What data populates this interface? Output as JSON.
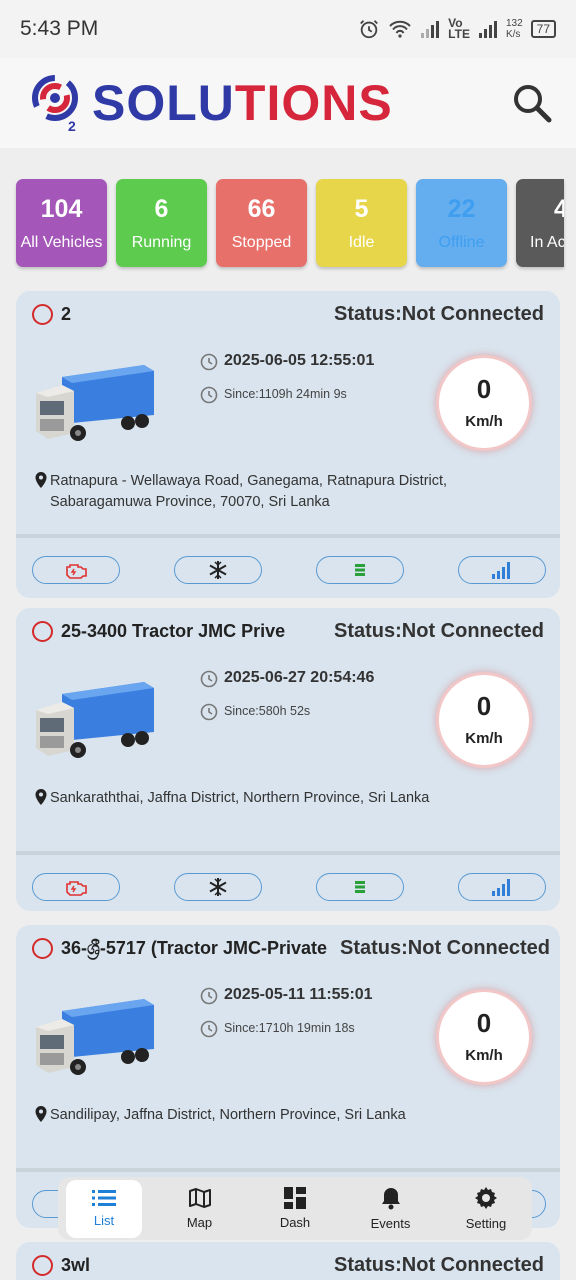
{
  "status_bar": {
    "time": "5:43 PM",
    "net_speed_top": "132",
    "net_speed_bottom": "K/s",
    "battery": "77",
    "volte_top": "Vo",
    "volte_bottom": "LTE"
  },
  "header": {
    "logo_sub": "2",
    "brand_blue_1": "SOLU",
    "brand_red": "TIONS",
    "brand_blue_2": ""
  },
  "summary": [
    {
      "count": "104",
      "label": "All Vehicles",
      "color": "#a457b8"
    },
    {
      "count": "6",
      "label": "Running",
      "color": "#5ccb4e"
    },
    {
      "count": "66",
      "label": "Stopped",
      "color": "#e8706a"
    },
    {
      "count": "5",
      "label": "Idle",
      "color": "#e7d64a"
    },
    {
      "count": "22",
      "label": "Offline",
      "color": "#64aef0"
    },
    {
      "count": "4",
      "label": "In Ac",
      "color": "#5a5a5a"
    }
  ],
  "vehicles": [
    {
      "name": "2",
      "status": "Status:Not Connected",
      "datetime": "2025-06-05 12:55:01",
      "since": "Since:1109h 24min 9s",
      "speed": "0",
      "unit": "Km/h",
      "address": "Ratnapura - Wellawaya Road, Ganegama, Ratnapura District, Sabaragamuwa Province, 70070, Sri Lanka"
    },
    {
      "name": "25-3400  Tractor JMC Prive",
      "status": "Status:Not Connected",
      "datetime": "2025-06-27 20:54:46",
      "since": "Since:580h 52s",
      "speed": "0",
      "unit": "Km/h",
      "address": "Sankaraththai, Jaffna District, Northern Province, Sri Lanka"
    },
    {
      "name": "36-ශ්‍රී-5717 (Tractor JMC-Private",
      "status": "Status:Not Connected",
      "datetime": "2025-05-11 11:55:01",
      "since": "Since:1710h 19min 18s",
      "speed": "0",
      "unit": "Km/h",
      "address": "Sandilipay, Jaffna District, Northern Province, Sri Lanka"
    },
    {
      "name": "3wl",
      "status": "Status:Not Connected"
    }
  ],
  "nav": {
    "list": "List",
    "map": "Map",
    "dash": "Dash",
    "events": "Events",
    "setting": "Setting"
  },
  "colors": {
    "accent": "#1e7fd8",
    "status_ring": "#d42a2a",
    "card_bg": "#d9e4ee"
  }
}
